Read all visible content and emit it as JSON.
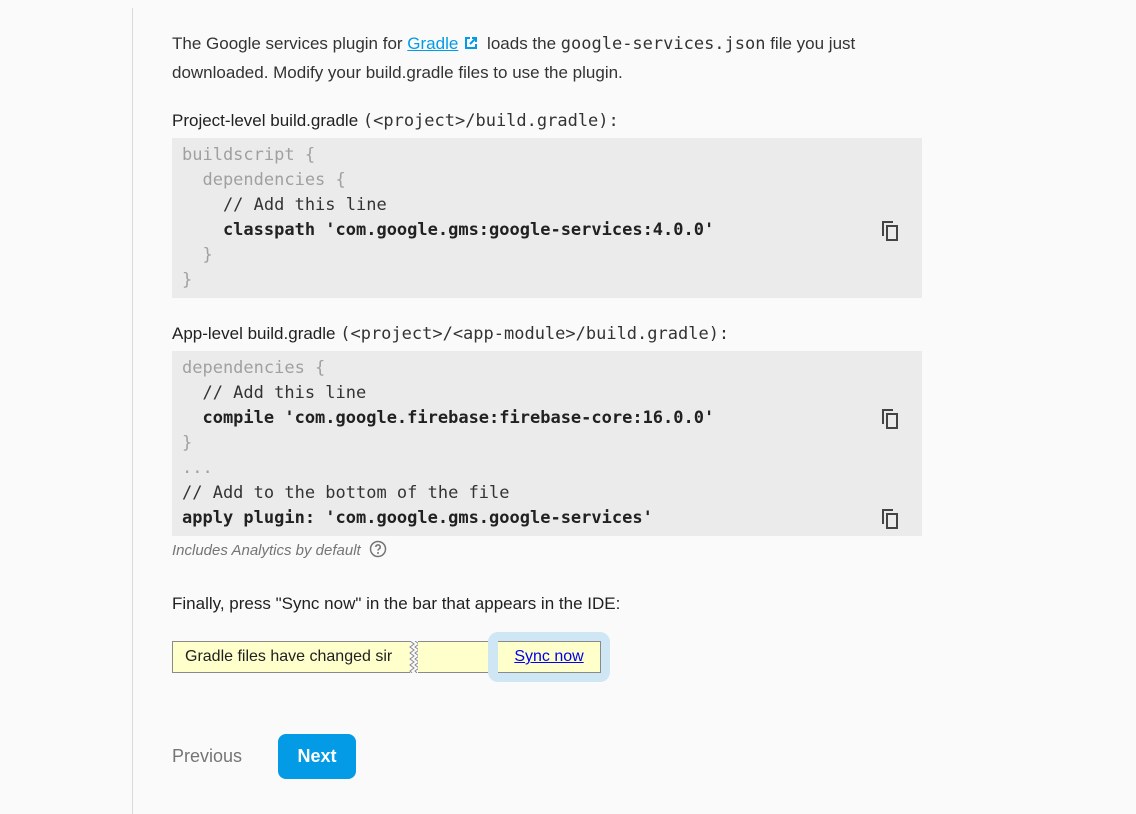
{
  "intro": {
    "prefix": "The Google services plugin for ",
    "link": "Gradle",
    "middle": " loads the ",
    "filename": "google-services.json",
    "suffix": " file you just downloaded. Modify your build.gradle files to use the plugin."
  },
  "project_level": {
    "label": "Project-level build.gradle",
    "path": "(<project>/build.gradle):",
    "lines": [
      "buildscript {",
      "  dependencies {",
      "    // Add this line",
      "    classpath 'com.google.gms:google-services:4.0.0'",
      "  }",
      "}"
    ]
  },
  "app_level": {
    "label": "App-level build.gradle",
    "path": "(<project>/<app-module>/build.gradle):",
    "lines": [
      "dependencies {",
      "  // Add this line",
      "  compile 'com.google.firebase:firebase-core:16.0.0'",
      "}",
      "...",
      "// Add to the bottom of the file",
      "apply plugin: 'com.google.gms.google-services'"
    ],
    "footnote": "Includes Analytics by default"
  },
  "finally": "Finally, press \"Sync now\" in the bar that appears in the IDE:",
  "sync_bar": {
    "message": "Gradle files have changed sir",
    "action": "Sync now"
  },
  "nav": {
    "previous": "Previous",
    "next": "Next"
  },
  "colors": {
    "accent": "#039be5",
    "code_bg": "#ebebeb",
    "ide_bar": "#ffffcc",
    "highlight": "#cfe6f5"
  }
}
